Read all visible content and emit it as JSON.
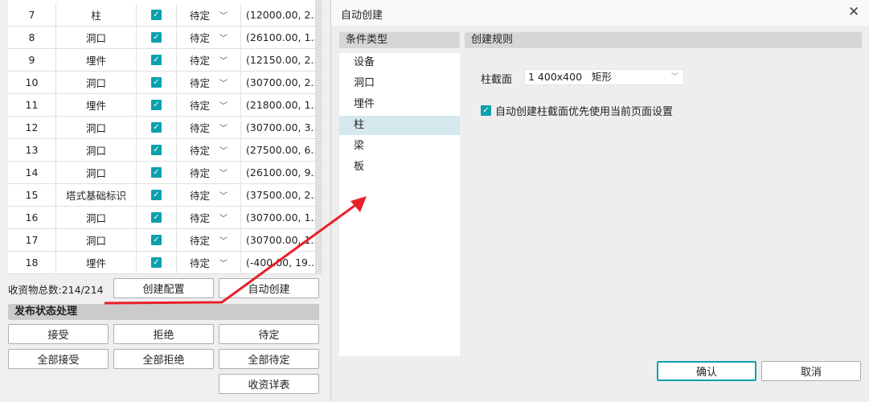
{
  "table": {
    "rows": [
      {
        "index": "7",
        "type": "柱",
        "status": "待定",
        "coord": "(12000.00, 2..."
      },
      {
        "index": "8",
        "type": "洞口",
        "status": "待定",
        "coord": "(26100.00, 1..."
      },
      {
        "index": "9",
        "type": "埋件",
        "status": "待定",
        "coord": "(12150.00, 2..."
      },
      {
        "index": "10",
        "type": "洞口",
        "status": "待定",
        "coord": "(30700.00, 2..."
      },
      {
        "index": "11",
        "type": "埋件",
        "status": "待定",
        "coord": "(21800.00, 1..."
      },
      {
        "index": "12",
        "type": "洞口",
        "status": "待定",
        "coord": "(30700.00, 3..."
      },
      {
        "index": "13",
        "type": "洞口",
        "status": "待定",
        "coord": "(27500.00, 6..."
      },
      {
        "index": "14",
        "type": "洞口",
        "status": "待定",
        "coord": "(26100.00, 9..."
      },
      {
        "index": "15",
        "type": "塔式基础标识",
        "status": "待定",
        "coord": "(37500.00, 2..."
      },
      {
        "index": "16",
        "type": "洞口",
        "status": "待定",
        "coord": "(30700.00, 1..."
      },
      {
        "index": "17",
        "type": "洞口",
        "status": "待定",
        "coord": "(30700.00, 1..."
      },
      {
        "index": "18",
        "type": "埋件",
        "status": "待定",
        "coord": "(-400.00, 19..."
      }
    ]
  },
  "left": {
    "total": "收资物总数:214/214",
    "create_config": "创建配置",
    "auto_create": "自动创建",
    "section": "发布状态处理",
    "accept": "接受",
    "reject": "拒绝",
    "pending": "待定",
    "accept_all": "全部接受",
    "reject_all": "全部拒绝",
    "pending_all": "全部待定",
    "details": "收资详表"
  },
  "dialog": {
    "title": "自动创建",
    "cond_header": "条件类型",
    "rule_header": "创建规则",
    "conditions": [
      "设备",
      "洞口",
      "埋件",
      "柱",
      "梁",
      "板"
    ],
    "selected": "柱",
    "section_label": "柱截面",
    "section_value": "1 400x400   矩形",
    "checkbox_label": "自动创建柱截面优先使用当前页面设置",
    "ok": "确认",
    "cancel": "取消"
  },
  "colors": {
    "accent": "#0aa1ad",
    "annotation": "#e8202a"
  }
}
